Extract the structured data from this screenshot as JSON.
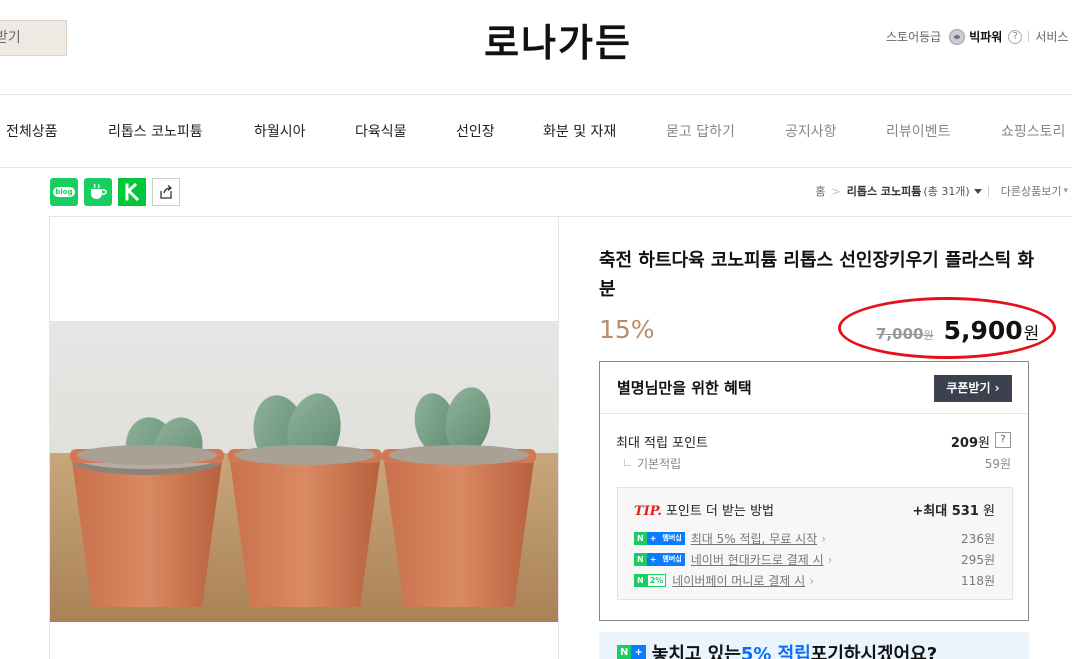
{
  "header": {
    "left_button_label": "받기",
    "store_title": "로나가든",
    "store_grade_label": "스토어등급",
    "store_grade_name": "빅파워",
    "help_label": "?",
    "service_label": "서비스"
  },
  "nav": {
    "items": [
      {
        "label": "전체상품"
      },
      {
        "label": "리톱스 코노피튬"
      },
      {
        "label": "하월시아"
      },
      {
        "label": "다육식물"
      },
      {
        "label": "선인장"
      },
      {
        "label": "화분 및 자재"
      },
      {
        "label": "묻고 답하기"
      },
      {
        "label": "공지사항"
      },
      {
        "label": "리뷰이벤트"
      },
      {
        "label": "쇼핑스토리"
      }
    ]
  },
  "share": {
    "blog_label": "blog"
  },
  "breadcrumb": {
    "home": "홈",
    "category": "리톱스 코노피튬",
    "count": "(총 31개)",
    "other": "다른상품보기"
  },
  "product": {
    "name": "축전 하트다육 코노피튬 리톱스 선인장키우기 플라스틱 화분",
    "discount": "15%",
    "original_price": "7,000",
    "original_unit": "원",
    "sale_price": "5,900",
    "sale_unit": "원"
  },
  "benefit": {
    "title": "별명님만을 위한 혜택",
    "coupon_button": "쿠폰받기 ›",
    "max_points_label": "최대 적립 포인트",
    "max_points_value": "209",
    "unit": "원",
    "help": "?",
    "basic_label": "기본적립",
    "basic_value": "59원",
    "tip_label": "TIP.",
    "tip_title": "포인트 더 받는 방법",
    "tip_max_prefix": "+최대",
    "tip_max_value": "531",
    "tip_max_unit": " 원",
    "tips": [
      {
        "badge": "멤버십",
        "text": "최대 5% 적립, 무료 시작",
        "amount": "236원"
      },
      {
        "badge": "멤버십",
        "text": "네이버 현대카드로 결제 시",
        "amount": "295원"
      },
      {
        "badge": "2%",
        "text": "네이버페이 머니로 결제 시",
        "amount": "118원"
      }
    ]
  },
  "promo": {
    "pre": "놓치고 있는 ",
    "highlight": "5% 적립",
    "post": " 포기하시겠어요?"
  },
  "colors": {
    "accent_discount": "#b78d6a",
    "naver_green": "#19ce60",
    "naver_blue": "#0a7cff",
    "highlight_oval": "#e3121a"
  }
}
